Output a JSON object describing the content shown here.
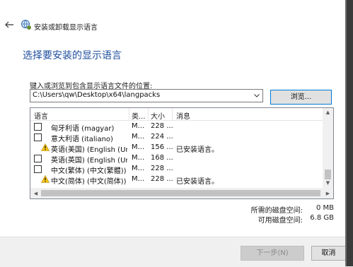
{
  "window": {
    "title": "安装或卸载显示语言"
  },
  "page": {
    "heading": "选择要安装的显示语言",
    "path_label": "键入或浏览到包含显示语言文件的位置:",
    "path_value": "C:\\Users\\qw\\Desktop\\x64\\langpacks",
    "browse_label": "浏览..."
  },
  "list": {
    "columns": [
      "语言",
      "类...",
      "大小",
      "消息"
    ],
    "rows": [
      {
        "language": "匈牙利语 (magyar)",
        "type": "M...",
        "size": "228 ...",
        "message": "",
        "warning": false
      },
      {
        "language": "意大利语 (italiano)",
        "type": "M...",
        "size": "224 ...",
        "message": "",
        "warning": false
      },
      {
        "language": "英语(美国) (English (Un...",
        "type": "M...",
        "size": "156 ...",
        "message": "已安装语言。",
        "warning": true
      },
      {
        "language": "英语(英国) (English (Un...",
        "type": "M...",
        "size": "168 ...",
        "message": "",
        "warning": false
      },
      {
        "language": "中文(繁体) (中文(繁體))",
        "type": "M...",
        "size": "228 ...",
        "message": "",
        "warning": false
      },
      {
        "language": "中文(简体) (中文(简体))",
        "type": "M...",
        "size": "228 ...",
        "message": "已安装语言。",
        "warning": true
      }
    ]
  },
  "disk": {
    "required_label": "所需的磁盘空间:",
    "required_value": "0 MB",
    "available_label": "可用磁盘空间:",
    "available_value": "6.8 GB"
  },
  "footer": {
    "next_label": "下一步(N)",
    "cancel_label": "取消"
  }
}
